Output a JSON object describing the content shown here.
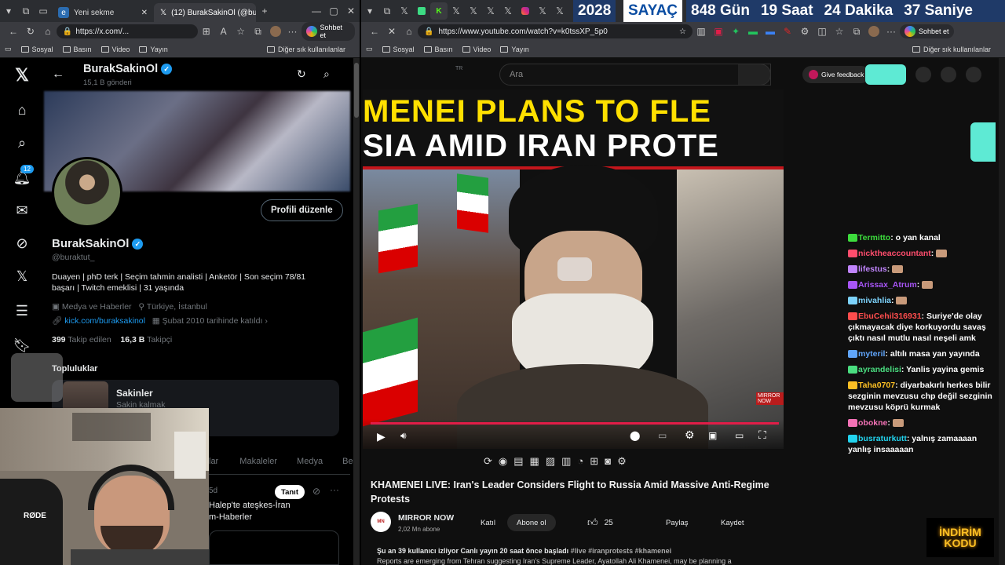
{
  "left_browser": {
    "tabs": [
      {
        "label": "Yeni sekme",
        "icon": "edge-icon",
        "active": false
      },
      {
        "label": "(12) BurakSakinOl (@bura",
        "icon": "x-logo-icon",
        "active": true
      }
    ],
    "url": "https://x.com/...",
    "sohbet_label": "Sohbet et",
    "bookmarks": [
      "Sosyal",
      "Basın",
      "Video",
      "Yayın"
    ],
    "other_bookmarks": "Diğer sık kullanılanlar"
  },
  "x_profile": {
    "header_name": "BurakSakinOl",
    "header_posts": "15,1 B gönderi",
    "edit_button": "Profili düzenle",
    "display_name": "BurakSakinOl",
    "handle": "@buraktut_",
    "bio": "Duayen | phD terk | Seçim tahmin analisti | Anketör | Son seçim 78/81 başarı | Twitch emeklisi | 31 yaşında",
    "category": "Medya ve Haberler",
    "location": "Türkiye, İstanbul",
    "link": "kick.com/buraksakinol",
    "joined": "Şubat 2010 tarihinde katıldı",
    "following_count": "399",
    "following_label": "Takip edilen",
    "followers_count": "16,3 B",
    "followers_label": "Takipçi",
    "communities_title": "Topluluklar",
    "community_name": "Sakinler",
    "community_sub": "Sakin kalmak",
    "tabs_partial": [
      "lar",
      "Makaleler",
      "Medya",
      "Be"
    ],
    "notif_count": "12",
    "post_time": "5d",
    "translate_button": "Tanıt",
    "post_text_1": "Halep'te ateşkes-İran",
    "post_text_2": "m-Haberler",
    "mic_brand": "RØDE"
  },
  "countdown": {
    "year": "2028",
    "label": "SAYAÇ",
    "days": "848 Gün",
    "hours": "19 Saat",
    "minutes": "24 Dakika",
    "seconds": "37 Saniye"
  },
  "right_browser": {
    "url": "https://www.youtube.com/watch?v=k0tssXP_5p0",
    "sohbet_label": "Sohbet et",
    "bookmarks": [
      "Sosyal",
      "Basın",
      "Video",
      "Yayın"
    ],
    "other_bookmarks": "Diğer sık kullanılanlar"
  },
  "youtube": {
    "country": "TR",
    "search_placeholder": "Ara",
    "feedback": "Give feedback",
    "thumb_line1": "MENEI PLANS TO FLE",
    "thumb_line2": "SIA AMID IRAN PROTE",
    "title": "KHAMENEI LIVE: Iran's Leader Considers Flight to Russia Amid Massive Anti-Regime Protests",
    "channel": "MIRROR NOW",
    "subscribers": "2,02 Mn abone",
    "join_button": "Katıl",
    "subscribe_button": "Abone ol",
    "likes": "25",
    "share_button": "Paylaş",
    "save_button": "Kaydet",
    "meta_line": "Şu an 39 kullanıcı izliyor  Canlı yayın 20 saat önce başladı",
    "hashtags": "#live #iranprotests #khamenei",
    "desc_line": "Reports are emerging from Tehran suggesting Iran's Supreme Leader, Ayatollah Ali Khamenei, may be planning a",
    "watermark_logo": "MIRROR NOW"
  },
  "chat": [
    {
      "user": "Termitto",
      "color": "#3ddc3d",
      "text": "o yan kanal"
    },
    {
      "user": "nicktheaccountant",
      "color": "#ff4d6d",
      "text": ""
    },
    {
      "user": "lifestus",
      "color": "#c084fc",
      "text": ""
    },
    {
      "user": "Arissax_Atrum",
      "color": "#a855f7",
      "text": ""
    },
    {
      "user": "mivahlia",
      "color": "#7dd3fc",
      "text": ""
    },
    {
      "user": "EbuCehil316931",
      "color": "#ff4d4d",
      "text": "Suriye'de olay çıkmayacak diye korkuyordu savaş çıktı nasıl mutlu nasıl neşeli amk"
    },
    {
      "user": "myteril",
      "color": "#60a5fa",
      "text": "altılı masa yan yayında"
    },
    {
      "user": "ayrandelisi",
      "color": "#4ade80",
      "text": "Yanlis yayina gemis"
    },
    {
      "user": "Taha0707",
      "color": "#fbbf24",
      "text": "diyarbakırlı herkes bilir sezginin mevzusu chp değil sezginin mevzusu köprü kurmak"
    },
    {
      "user": "obokne",
      "color": "#f472b6",
      "text": ""
    },
    {
      "user": "busraturkutt",
      "color": "#22d3ee",
      "text": "yalnış zamaaaan yanlış insaaaaan"
    }
  ],
  "promo": {
    "line1": "İNDİRİM",
    "line2": "KODU"
  }
}
